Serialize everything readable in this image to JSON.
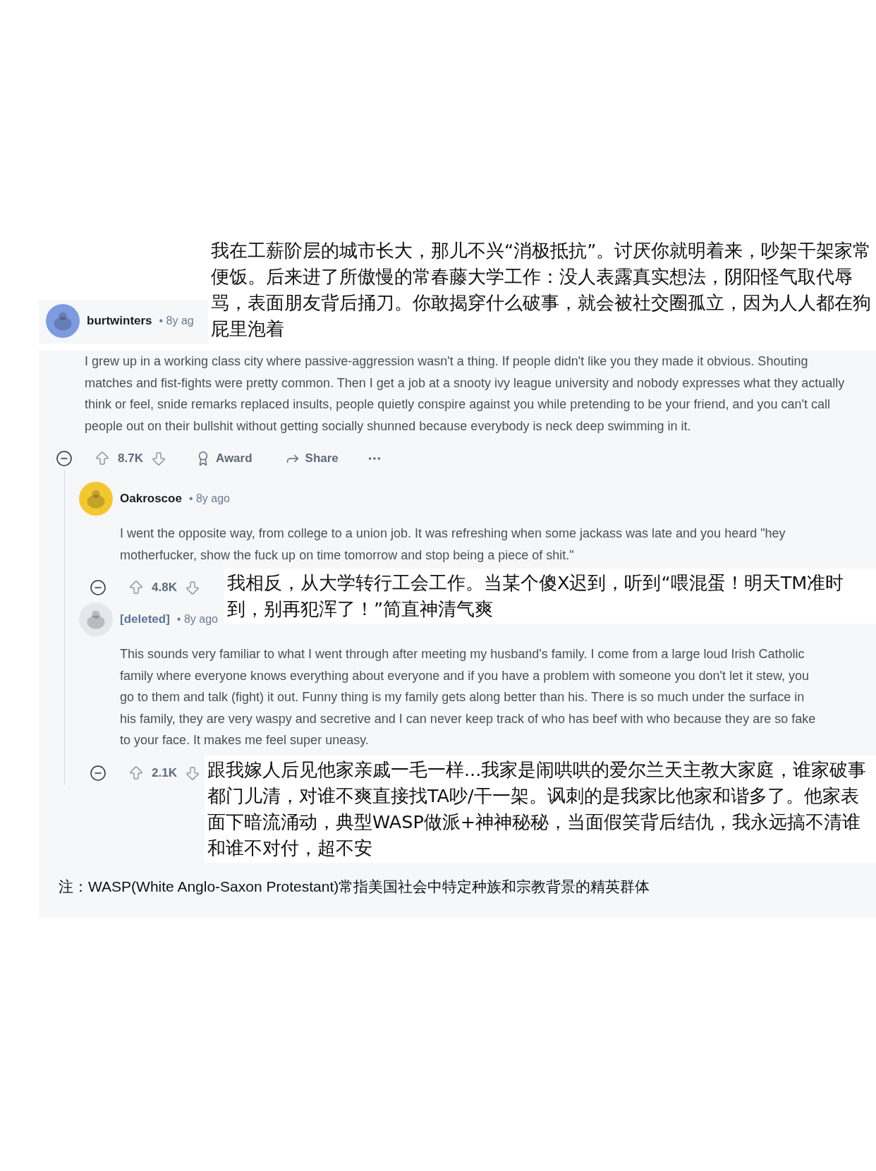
{
  "thread": {
    "comment": {
      "author": "burtwinters",
      "meta": "• 8y ag",
      "body": "I grew up in a working class city where passive-aggression wasn't a thing. If people didn't like you they made it obvious. Shouting matches and fist-fights were pretty common. Then I get a job at a snooty ivy league university and nobody expresses what they actually think or feel, snide remarks replaced insults, people quietly conspire against you while pretending to be your friend, and you can't call people out on their bullshit without getting socially shunned because everybody is neck deep swimming in it.",
      "votes": "8.7K",
      "award": "Award",
      "share": "Share"
    },
    "replies": [
      {
        "author": "Oakroscoe",
        "meta": "• 8y ago",
        "body": "I went the opposite way, from college to a union job. It was refreshing when some jackass was late and you heard \"hey motherfucker, show the fuck up on time tomorrow and stop being a piece of shit.\"",
        "votes": "4.8K"
      },
      {
        "author": "[deleted]",
        "meta": "• 8y ago",
        "body": "This sounds very familiar to what I went through after meeting my husband's family. I come from a large loud Irish Catholic family where everyone knows everything about everyone and if you have a problem with someone you don't let it stew, you go to them and talk (fight) it out. Funny thing is my family gets along better than his. There is so much under the surface in his family, they are very waspy and secretive and I can never keep track of who has beef with who because they are so fake to your face. It makes me feel super uneasy.",
        "votes": "2.1K"
      }
    ]
  },
  "translations": [
    "我在工薪阶层的城市长大，那儿不兴“消极抵抗”。讨厌你就明着来，吵架干架家常便饭。后来进了所傲慢的常春藤大学工作：没人表露真实想法，阴阳怪气取代辱骂，表面朋友背后捅刀。你敢揭穿什么破事，就会被社交圈孤立，因为人人都在狗屁里泡着",
    "我相反，从大学转行工会工作。当某个傻X迟到，听到“喂混蛋！明天TM准时到，别再犯浑了！”简直神清气爽",
    "跟我嫁人后见他家亲戚一毛一样...我家是闹哄哄的爱尔兰天主教大家庭，谁家破事都门儿清，对谁不爽直接找TA吵/干一架。讽刺的是我家比他家和谐多了。他家表面下暗流涌动，典型WASP做派+神神秘秘，当面假笑背后结仇，我永远搞不清谁和谁不对付，超不安"
  ],
  "note": "注：WASP(White Anglo-Saxon Protestant)常指美国社会中特定种族和宗教背景的精英群体"
}
